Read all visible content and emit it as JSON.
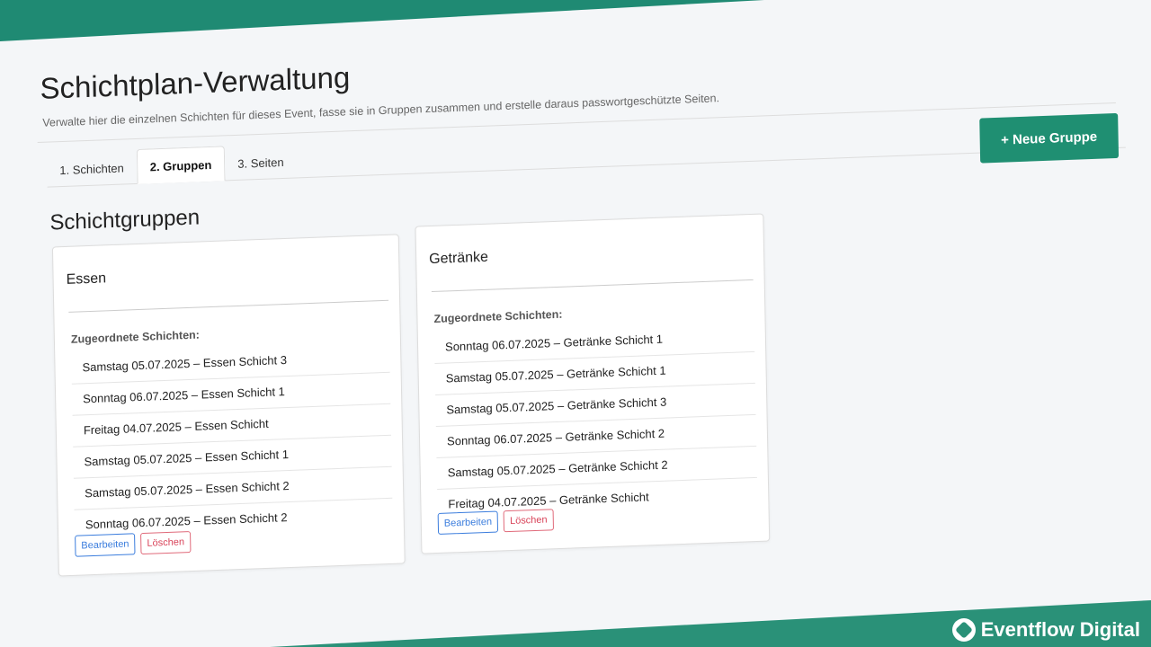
{
  "header": {
    "title": "Schichtplan-Verwaltung",
    "subtitle": "Verwalte hier die einzelnen Schichten für dieses Event, fasse sie in Gruppen zusammen und erstelle daraus passwortgeschützte Seiten."
  },
  "tabs": [
    {
      "label": "1. Schichten",
      "active": false
    },
    {
      "label": "2. Gruppen",
      "active": true
    },
    {
      "label": "3. Seiten",
      "active": false
    }
  ],
  "toolbar": {
    "new_group_label": "+ Neue Gruppe"
  },
  "section": {
    "title": "Schichtgruppen"
  },
  "groups": [
    {
      "title": "Essen",
      "assigned_label": "Zugeordnete Schichten:",
      "shifts": [
        "Samstag 05.07.2025 – Essen Schicht 3",
        "Sonntag 06.07.2025 – Essen Schicht 1",
        "Freitag 04.07.2025 – Essen Schicht",
        "Samstag 05.07.2025 – Essen Schicht 1",
        "Samstag 05.07.2025 – Essen Schicht 2",
        "Sonntag 06.07.2025 – Essen Schicht 2"
      ],
      "edit_label": "Bearbeiten",
      "delete_label": "Löschen"
    },
    {
      "title": "Getränke",
      "assigned_label": "Zugeordnete Schichten:",
      "shifts": [
        "Sonntag 06.07.2025 – Getränke Schicht 1",
        "Samstag 05.07.2025 – Getränke Schicht 1",
        "Samstag 05.07.2025 – Getränke Schicht 3",
        "Sonntag 06.07.2025 – Getränke Schicht 2",
        "Samstag 05.07.2025 – Getränke Schicht 2",
        "Freitag 04.07.2025 – Getränke Schicht"
      ],
      "edit_label": "Bearbeiten",
      "delete_label": "Löschen"
    }
  ],
  "brand": {
    "name": "Eventflow Digital"
  },
  "colors": {
    "accent": "#1f8f72",
    "edit": "#3b7ddd",
    "delete": "#d9445a"
  }
}
